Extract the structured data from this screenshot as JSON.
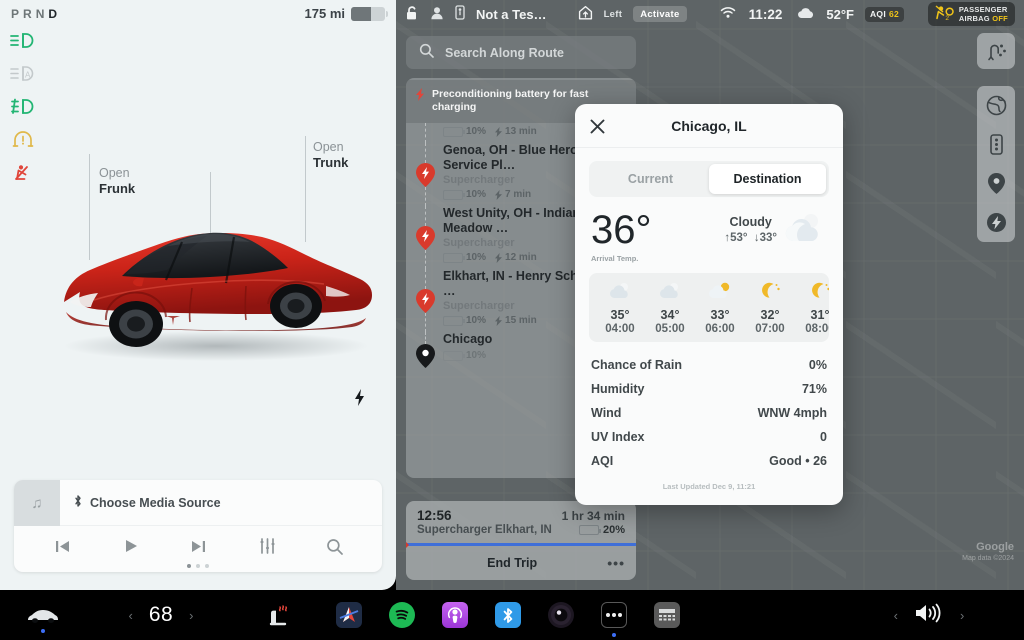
{
  "car_panel": {
    "gear": {
      "label": "PRND",
      "active": "D"
    },
    "range": {
      "value": "175 mi",
      "battery_pct": 60
    },
    "status_icons": [
      {
        "name": "headlight-on-icon",
        "color": "#22b573"
      },
      {
        "name": "auto-highbeam-icon",
        "color": "#c3c9cb"
      },
      {
        "name": "fog-light-icon",
        "color": "#22b573"
      },
      {
        "name": "tire-pressure-icon",
        "color": "#e0b84a"
      },
      {
        "name": "seatbelt-warning-icon",
        "color": "#e0453a"
      }
    ],
    "actions": {
      "frunk": {
        "line1": "Open",
        "line2": "Frunk"
      },
      "trunk": {
        "line1": "Open",
        "line2": "Trunk"
      },
      "lock": "unlock-icon",
      "charge_port": "charge-bolt-icon"
    },
    "media": {
      "source_label": "Choose Media Source",
      "source_icon": "bluetooth-icon",
      "art_icon": "music-note-icon",
      "controls": [
        "previous-track",
        "play",
        "next-track",
        "equalizer",
        "search"
      ],
      "page_dots": 3,
      "active_dot": 0
    }
  },
  "map": {
    "topbar": {
      "lock_icon": "unlock-icon",
      "profile_icon": "profile-icon",
      "phonekey_icon": "phone-key-icon",
      "car_name": "Not a Tes…",
      "home_icon": "home-icon",
      "home_label": "Left",
      "activate_label": "Activate",
      "wifi_icon": "wifi-icon",
      "time": "11:22",
      "weather_icon": "cloud-icon",
      "temperature": "52°F",
      "aqi_label": "AQI",
      "aqi_value": "62",
      "airbag_line1": "PASSENGER",
      "airbag_line2": "AIRBAG",
      "airbag_state": "OFF"
    },
    "search": {
      "placeholder": "Search Along Route",
      "icon": "search-icon"
    },
    "precondition_notice": "Preconditioning battery for fast charging",
    "stops": [
      {
        "name": "",
        "sub": "",
        "soc": "10%",
        "time": "13 min",
        "pin": "supercharger",
        "partial": true
      },
      {
        "name": "Genoa, OH - Blue Heron Service Pl…",
        "sub": "Supercharger",
        "soc": "10%",
        "time": "7 min",
        "pin": "supercharger"
      },
      {
        "name": "West Unity, OH - Indian Meadow …",
        "sub": "Supercharger",
        "soc": "10%",
        "time": "12 min",
        "pin": "supercharger"
      },
      {
        "name": "Elkhart, IN - Henry Schricker …",
        "sub": "Supercharger",
        "soc": "10%",
        "time": "15 min",
        "pin": "supercharger"
      },
      {
        "name": "Chicago",
        "sub": "",
        "soc": "10%",
        "time": "",
        "pin": "destination"
      }
    ],
    "trip": {
      "eta": "12:56",
      "duration": "1 hr 34 min",
      "destination": "Supercharger Elkhart, IN",
      "arrival_soc": "20%",
      "end_trip_label": "End Trip",
      "more_label": "•••"
    },
    "controls_top": [
      {
        "name": "route-overview-icon"
      }
    ],
    "controls": [
      {
        "name": "globe-icon"
      },
      {
        "name": "traffic-light-icon"
      },
      {
        "name": "map-pin-icon"
      },
      {
        "name": "charging-icon"
      }
    ],
    "attribution": {
      "brand": "Google",
      "line": "Map data ©2024"
    }
  },
  "weather_popup": {
    "title": "Chicago, IL",
    "close_icon": "close-icon",
    "tabs": [
      {
        "label": "Current",
        "active": false
      },
      {
        "label": "Destination",
        "active": true
      }
    ],
    "temp": "36°",
    "temp_caption": "Arrival Temp.",
    "condition": "Cloudy",
    "high": "↑53°",
    "low": "↓33°",
    "condition_icon": "cloudy-icon",
    "hourly": [
      {
        "temp": "35°",
        "time": "04:00",
        "icon": "cloudy-icon"
      },
      {
        "temp": "34°",
        "time": "05:00",
        "icon": "cloudy-icon"
      },
      {
        "temp": "33°",
        "time": "06:00",
        "icon": "partly-cloudy-icon"
      },
      {
        "temp": "32°",
        "time": "07:00",
        "icon": "moon-icon"
      },
      {
        "temp": "31°",
        "time": "08:00",
        "icon": "moon-icon"
      }
    ],
    "details": [
      {
        "key": "Chance of Rain",
        "value": "0%"
      },
      {
        "key": "Humidity",
        "value": "71%"
      },
      {
        "key": "Wind",
        "value": "WNW 4mph"
      },
      {
        "key": "UV Index",
        "value": "0"
      },
      {
        "key": "AQI",
        "value": "Good • 26"
      }
    ],
    "last_updated": "Last Updated Dec 9, 11:21"
  },
  "taskbar": {
    "car_icon": "car-icon",
    "climate_temp": "68",
    "left_chevron": "‹",
    "right_chevron": "›",
    "seat_heater_icon": "heated-seat-icon",
    "apps": [
      {
        "name": "navigation-app-icon",
        "color": "#2b3a58"
      },
      {
        "name": "spotify-app-icon",
        "color": "#1db954"
      },
      {
        "name": "podcasts-app-icon",
        "color": "#b150e2"
      },
      {
        "name": "bluetooth-app-icon",
        "color": "#2f9ae8"
      },
      {
        "name": "dashcam-app-icon",
        "color": "#211a26"
      },
      {
        "name": "toybox-app-icon",
        "color": "#1a1a1a"
      },
      {
        "name": "calculator-app-icon",
        "color": "#4a4a4a"
      }
    ],
    "volume_icon": "volume-icon",
    "vol_left_chevron": "‹",
    "vol_right_chevron": "›"
  }
}
